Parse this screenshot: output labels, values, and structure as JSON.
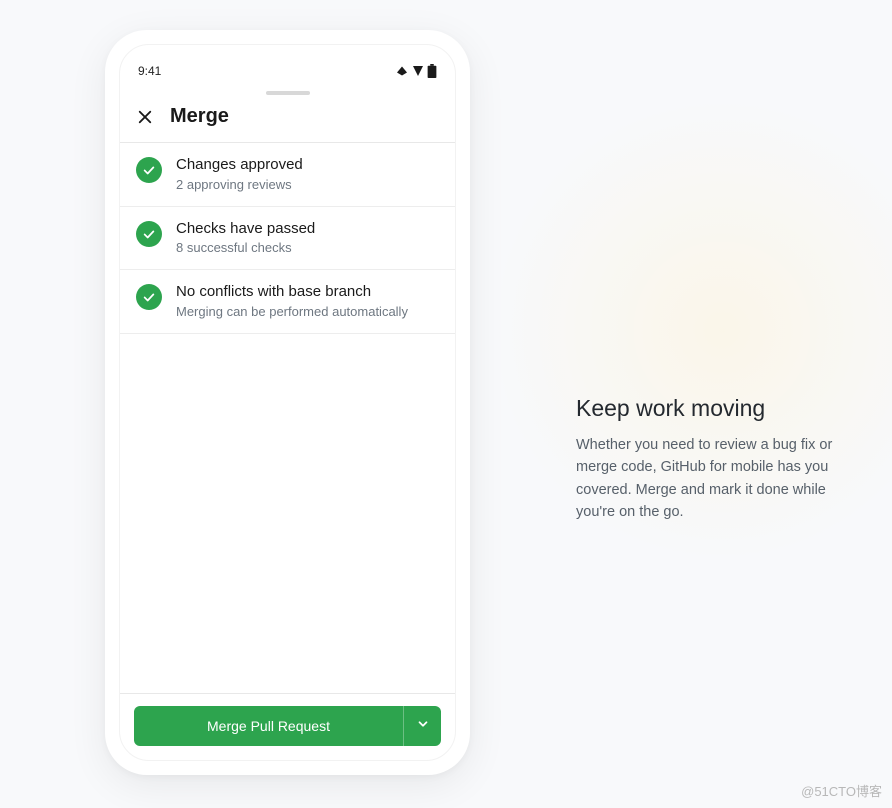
{
  "statusBar": {
    "time": "9:41"
  },
  "header": {
    "title": "Merge"
  },
  "statusItems": [
    {
      "title": "Changes approved",
      "subtitle": "2 approving reviews"
    },
    {
      "title": "Checks have passed",
      "subtitle": "8 successful checks"
    },
    {
      "title": "No conflicts with base branch",
      "subtitle": "Merging can be performed automatically"
    }
  ],
  "mergeButton": {
    "label": "Merge Pull Request"
  },
  "promo": {
    "heading": "Keep work moving",
    "body": "Whether you need to review a bug fix or merge code, GitHub for mobile has you covered. Merge and mark it done while you're on the go."
  },
  "watermark": "@51CTO博客"
}
